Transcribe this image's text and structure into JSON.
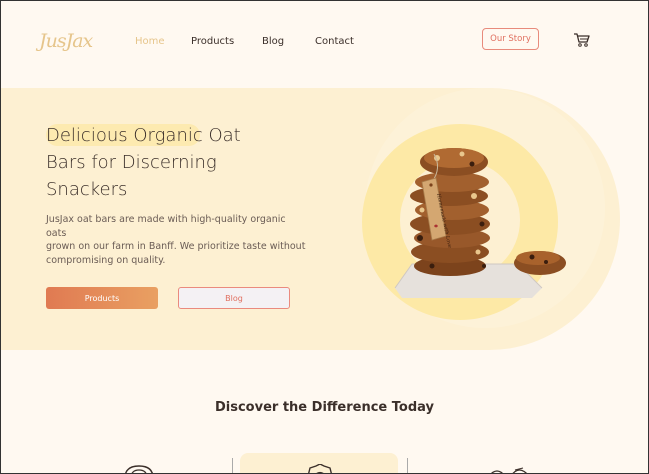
{
  "brand": {
    "logo": "JusJax"
  },
  "nav": {
    "items": [
      "Home",
      "Products",
      "Blog",
      "Contact"
    ],
    "active": "Home",
    "cta": "Our Story"
  },
  "hero": {
    "title_line1": "Delicious Organic Oat",
    "title_line2": "Bars for Discerning",
    "title_line3": "Snackers",
    "text_line1": "JusJax oat bars are made with high-quality organic oats",
    "text_line2": "grown on our farm in Banff. We prioritize taste without",
    "text_line3": "compromising on quality.",
    "primary_button": "Products",
    "secondary_button": "Blog",
    "tag_text": "Homemade with Love"
  },
  "discover": {
    "heading": "Discover the Difference Today"
  },
  "colors": {
    "background": "#fff9f1",
    "hero_bg": "#fdf0d2",
    "accent": "#e07a52",
    "outline_accent": "#ea8a7e",
    "logo": "#e6c58b",
    "text": "#3b2f2a"
  },
  "icons": [
    "cart-icon",
    "feature-icon-1",
    "feature-icon-2",
    "feature-icon-3"
  ]
}
